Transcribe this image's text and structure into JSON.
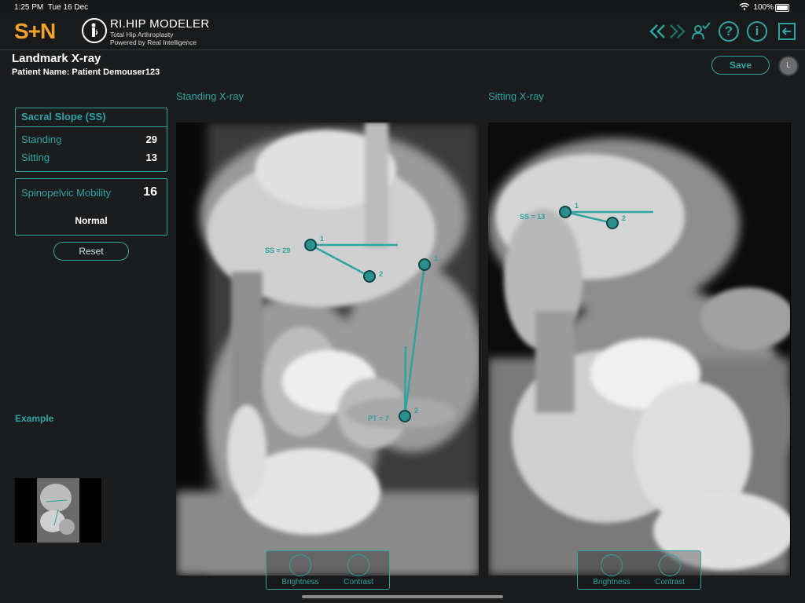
{
  "status_bar": {
    "time": "1:25 PM",
    "date": "Tue 16 Dec",
    "battery": "100%"
  },
  "header": {
    "logo": "S+N",
    "app_title": "RI.HIP MODELER",
    "app_subtitle_1": "Total Hip Arthroplasty",
    "app_subtitle_2": "Powered by Real Intelligence",
    "icons": [
      "double-chevron-left-icon",
      "double-chevron-right-icon",
      "user-check-icon",
      "help-icon",
      "info-icon",
      "exit-icon"
    ],
    "help_glyph": "?",
    "info_glyph": "i"
  },
  "page": {
    "title": "Landmark X-ray",
    "patient": "Patient Name: Patient Demouser123",
    "save_label": "Save",
    "avatar_initial": "L"
  },
  "sacral_slope": {
    "title": "Sacral Slope (SS)",
    "standing_label": "Standing",
    "standing_value": "29",
    "sitting_label": "Sitting",
    "sitting_value": "13"
  },
  "mobility": {
    "label": "Spinopelvic Mobility",
    "value": "16",
    "state": "Normal"
  },
  "reset_label": "Reset",
  "example_label": "Example",
  "standing_xray": {
    "title": "Standing X-ray",
    "ss_annotation": "SS = 29",
    "pt_annotation": "PT = 7",
    "point_1": "1",
    "point_2": "2",
    "point_3": "1",
    "point_4": "2",
    "brightness_label": "Brightness",
    "contrast_label": "Contrast"
  },
  "sitting_xray": {
    "title": "Sitting X-ray",
    "ss_annotation": "SS = 13",
    "point_1": "1",
    "point_2": "2",
    "brightness_label": "Brightness",
    "contrast_label": "Contrast"
  },
  "colors": {
    "accent": "#2ea3a2",
    "brand": "#f0a22a",
    "background": "#1b1c1d"
  }
}
